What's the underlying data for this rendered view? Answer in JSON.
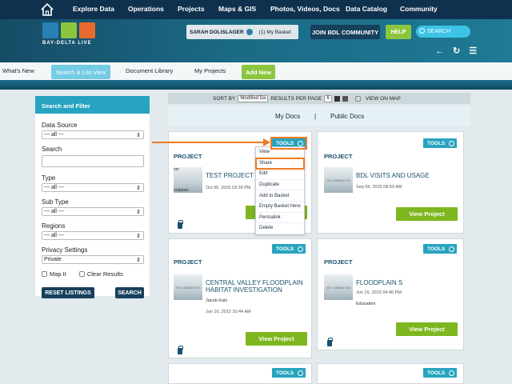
{
  "topnav": {
    "items": [
      "Explore Data",
      "Operations",
      "Projects",
      "Maps & GIS",
      "Photos, Videos, Docs",
      "Data Catalog",
      "Community"
    ]
  },
  "hero": {
    "logo_text": "BAY-DELTA LIVE",
    "user_name": "SARAH DOLISLAGER",
    "basket": "(1) My Basket",
    "join": "JOIN BDL COMMUNITY",
    "help": "HELP",
    "search_placeholder": "SEARCH",
    "icons": "← ↻ ☰"
  },
  "subnav": {
    "items": [
      "What's New",
      "Search & List View",
      "Document Library",
      "My Projects",
      "Add New"
    ]
  },
  "filter": {
    "title": "Search and Filter",
    "data_source_label": "Data Source",
    "data_source_value": "--- all ---",
    "search_label": "Search",
    "type_label": "Type",
    "type_value": "--- all ---",
    "subtype_label": "Sub Type",
    "subtype_value": "--- all ---",
    "regions_label": "Regions",
    "regions_value": "--- all ---",
    "privacy_label": "Privacy Settings",
    "privacy_value": "Private",
    "mapit_label": "Map It",
    "clear_label": "Clear Results",
    "reset_button": "RESET LISTINGS",
    "search_button": "SEARCH"
  },
  "sortbar": {
    "sort_by": "SORT BY",
    "sort_value": "Modified Da",
    "results_per_page": "RESULTS PER PAGE",
    "rpp_value": "6",
    "view_on_map": "VIEW ON MAP"
  },
  "tabs": {
    "my_docs": "My Docs",
    "sep": "|",
    "public_docs": "Public Docs"
  },
  "tools_label": "TOOLS",
  "project_label": "PROJECT",
  "view_project": "View Project",
  "thumb_text": "GE COMING SO",
  "cards": [
    {
      "title": "TEST PROJECT",
      "date": "Oct 06, 2015 03:39 PM",
      "thumb1": "ver",
      "thumb2": "oodplain"
    },
    {
      "title": "BDL VISITS AND USAGE",
      "date": "Sep 09, 2015 08:59 AM"
    },
    {
      "title": "CENTRAL VALLEY FLOODPLAIN HABITAT INVESTIGATION",
      "author": "Jacob Katz",
      "date": "Jun 16, 2015 10:44 AM"
    },
    {
      "title": "FLOODPLAIN S",
      "date": "Jun 15, 2015 04:46 PM",
      "category": "Education"
    }
  ],
  "dropdown": [
    "View",
    "Share",
    "Edit",
    "Duplicate",
    "Add to Basket",
    "Empty Basket Here",
    "Permalink",
    "Delete"
  ]
}
